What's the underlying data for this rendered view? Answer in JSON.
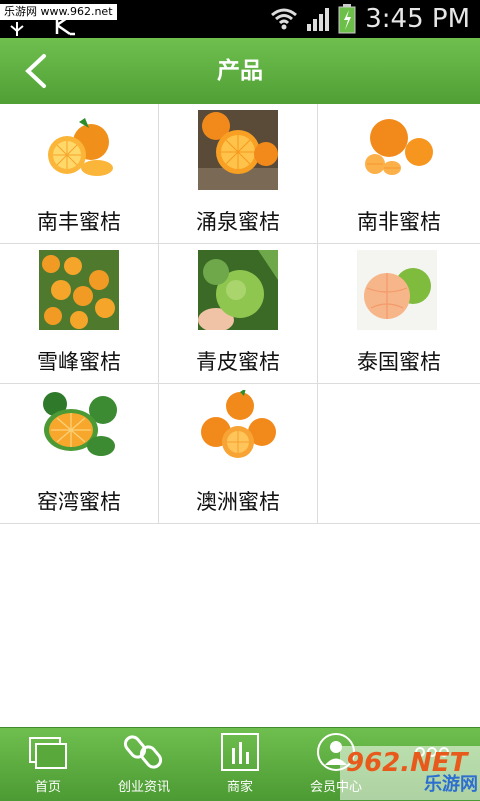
{
  "status_bar": {
    "watermark_text": "乐游网 www.962.net",
    "time": "3:45 PM",
    "icons": [
      "usb-icon",
      "k-icon",
      "wifi-icon",
      "signal-icon",
      "battery-icon"
    ]
  },
  "header": {
    "title": "产品",
    "back_icon": "chevron-left-icon",
    "color_top": "#6fbf4f",
    "color_bottom": "#4f9f35"
  },
  "products": [
    {
      "label": "南丰蜜桔"
    },
    {
      "label": "涌泉蜜桔"
    },
    {
      "label": "南非蜜桔"
    },
    {
      "label": "雪峰蜜桔"
    },
    {
      "label": "青皮蜜桔"
    },
    {
      "label": "泰国蜜桔"
    },
    {
      "label": "窑湾蜜桔"
    },
    {
      "label": "澳洲蜜桔"
    }
  ],
  "bottom_nav": {
    "items": [
      {
        "label": "首页",
        "icon": "home-icon"
      },
      {
        "label": "创业资讯",
        "icon": "link-icon"
      },
      {
        "label": "商家",
        "icon": "chart-icon"
      },
      {
        "label": "会员中心",
        "icon": "user-icon"
      },
      {
        "label": "",
        "icon": "more-icon"
      }
    ]
  },
  "watermark_bottom": {
    "main": "962.NET",
    "sub": "乐游网"
  }
}
